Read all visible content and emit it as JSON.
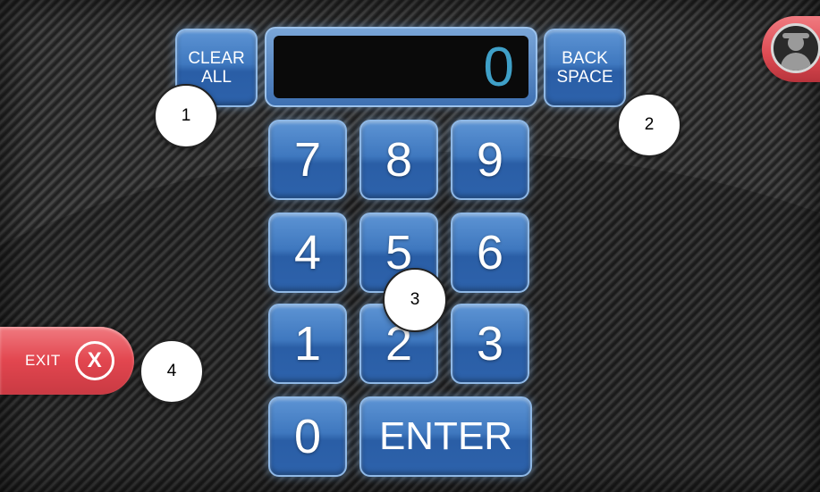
{
  "display": {
    "value": "0"
  },
  "controls": {
    "clear_all": "CLEAR\nALL",
    "back_space": "BACK\nSPACE",
    "enter": "ENTER",
    "exit": "EXIT",
    "exit_icon_glyph": "X"
  },
  "keypad": {
    "k7": "7",
    "k8": "8",
    "k9": "9",
    "k4": "4",
    "k5": "5",
    "k6": "6",
    "k1": "1",
    "k2": "2",
    "k3": "3",
    "k0": "0"
  },
  "callouts": {
    "c1": "1",
    "c2": "2",
    "c3": "3",
    "c4": "4"
  },
  "icons": {
    "user": "user-silhouette-icon",
    "exit": "close-circle-icon"
  },
  "colors": {
    "key_blue": "#3f78bf",
    "display_digit": "#3fa0c8",
    "exit_red": "#e2464f",
    "background": "#2a2a2a"
  }
}
